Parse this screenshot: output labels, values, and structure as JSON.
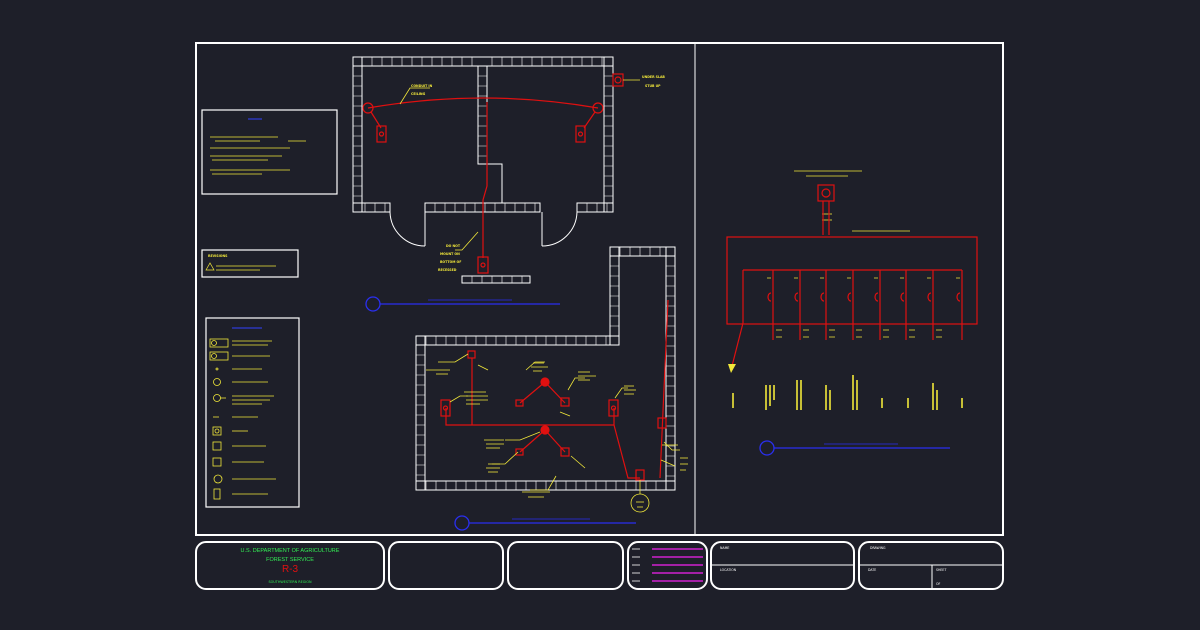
{
  "colors": {
    "background": "#1e1f29",
    "frame": "#ffffff",
    "electrical": "#e01010",
    "annotation": "#f2e83a",
    "callout": "#2a2ff0",
    "agency_text": "#33ee55",
    "revision_lines": "#d020d0"
  },
  "title_block": {
    "agency": "U.S. DEPARTMENT OF AGRICULTURE",
    "service": "FOREST SERVICE",
    "region": "R-3",
    "subtitle": "SOUTHWESTERN REGION",
    "name_label": "NAME",
    "location_label": "LOCATION",
    "drawing_label": "DRAWING",
    "date_label": "DATE",
    "sheet_label": "SHEET",
    "sheet_of": "OF"
  },
  "revisions": {
    "title": "REVISIONS",
    "note": "REVISION NOTE TEXT"
  },
  "plan_labels": {
    "conduit": "CONDUIT IN",
    "conduit2": "CEILING",
    "under_slab": "UNDER SLAB",
    "stubup": "STUB UP",
    "mount1": "DO NOT",
    "mount2": "MOUNT ON",
    "mount3": "BOTTOM OF",
    "mount4": "RECESSED"
  }
}
